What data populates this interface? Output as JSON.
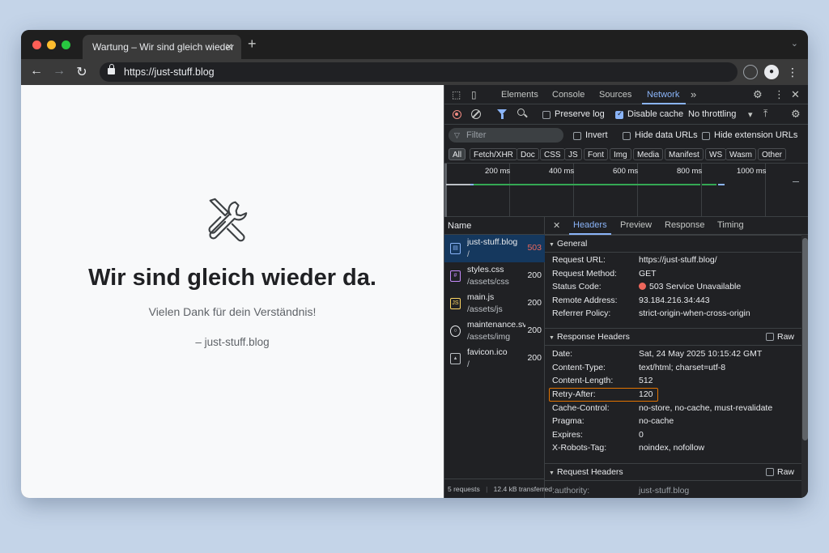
{
  "browser": {
    "tab_title": "Wartung – Wir sind gleich wieder",
    "tab_close": "✕",
    "new_tab": "+",
    "url": "https://just-stuff.blog"
  },
  "page": {
    "icon": "wrench-screwdriver-icon",
    "heading": "Wir sind gleich wieder da.",
    "subline": "Vielen Dank für dein Verständnis!",
    "signature": "– just-stuff.blog"
  },
  "devtools": {
    "tabs": [
      "Elements",
      "Console",
      "Sources",
      "Network"
    ],
    "active_tab": "Network",
    "more_tabs": "»",
    "toolbar": {
      "preserve_log": "Preserve log",
      "disable_cache": "Disable cache",
      "throttling": "No throttling",
      "dropdown_arrow": "▾"
    },
    "filter": {
      "placeholder": "Filter",
      "invert": "Invert",
      "hide_data_urls": "Hide data URLs",
      "hide_extension_urls": "Hide extension URLs"
    },
    "type_filters": [
      "All",
      "Fetch/XHR",
      "Doc",
      "CSS",
      "JS",
      "Font",
      "Img",
      "Media",
      "Manifest",
      "WS",
      "Wasm",
      "Other"
    ],
    "timeline_labels": [
      "200 ms",
      "400 ms",
      "600 ms",
      "800 ms",
      "1000 ms"
    ],
    "name_header": "Name",
    "requests": [
      {
        "name": "just-stuff.blog",
        "path": "/",
        "status": "503",
        "type": "doc"
      },
      {
        "name": "styles.css",
        "path": "/assets/css",
        "status": "200",
        "type": "css"
      },
      {
        "name": "main.js",
        "path": "/assets/js",
        "status": "200",
        "type": "js"
      },
      {
        "name": "maintenance.svg",
        "path": "/assets/img",
        "status": "200",
        "type": "svg"
      },
      {
        "name": "favicon.ico",
        "path": "/",
        "status": "200",
        "type": "img"
      }
    ],
    "summary": {
      "requests": "5 requests",
      "transferred": "12.4 kB transferred"
    },
    "detail_tabs": [
      "Headers",
      "Preview",
      "Response",
      "Timing"
    ],
    "close_glyph": "✕",
    "general": {
      "title": "General",
      "rows": [
        {
          "key": "Request URL:",
          "value": "https://just-stuff.blog/"
        },
        {
          "key": "Request Method:",
          "value": "GET"
        },
        {
          "key": "Status Code:",
          "value": "503 Service Unavailable"
        },
        {
          "key": "Remote Address:",
          "value": "93.184.216.34:443"
        },
        {
          "key": "Referrer Policy:",
          "value": "strict-origin-when-cross-origin"
        }
      ]
    },
    "response_headers": {
      "title": "Response Headers",
      "raw": "Raw",
      "rows": [
        {
          "key": "Date:",
          "value": "Sat, 24 May 2025 10:15:42 GMT"
        },
        {
          "key": "Content-Type:",
          "value": "text/html; charset=utf-8"
        },
        {
          "key": "Content-Length:",
          "value": "512"
        },
        {
          "key": "Retry-After:",
          "value": "120"
        },
        {
          "key": "Cache-Control:",
          "value": "no-store, no-cache, must-revalidate"
        },
        {
          "key": "Pragma:",
          "value": "no-cache"
        },
        {
          "key": "Expires:",
          "value": "0"
        },
        {
          "key": "X-Robots-Tag:",
          "value": "noindex, nofollow"
        }
      ]
    },
    "request_headers": {
      "title": "Request Headers",
      "raw": "Raw",
      "rows": [
        {
          "key": ":authority:",
          "value": "just-stuff.blog"
        }
      ]
    }
  },
  "colors": {
    "status_error": "#ee675c",
    "accent": "#8ab4f8",
    "highlight_border": "#e37400",
    "selected_row": "#15385e"
  }
}
